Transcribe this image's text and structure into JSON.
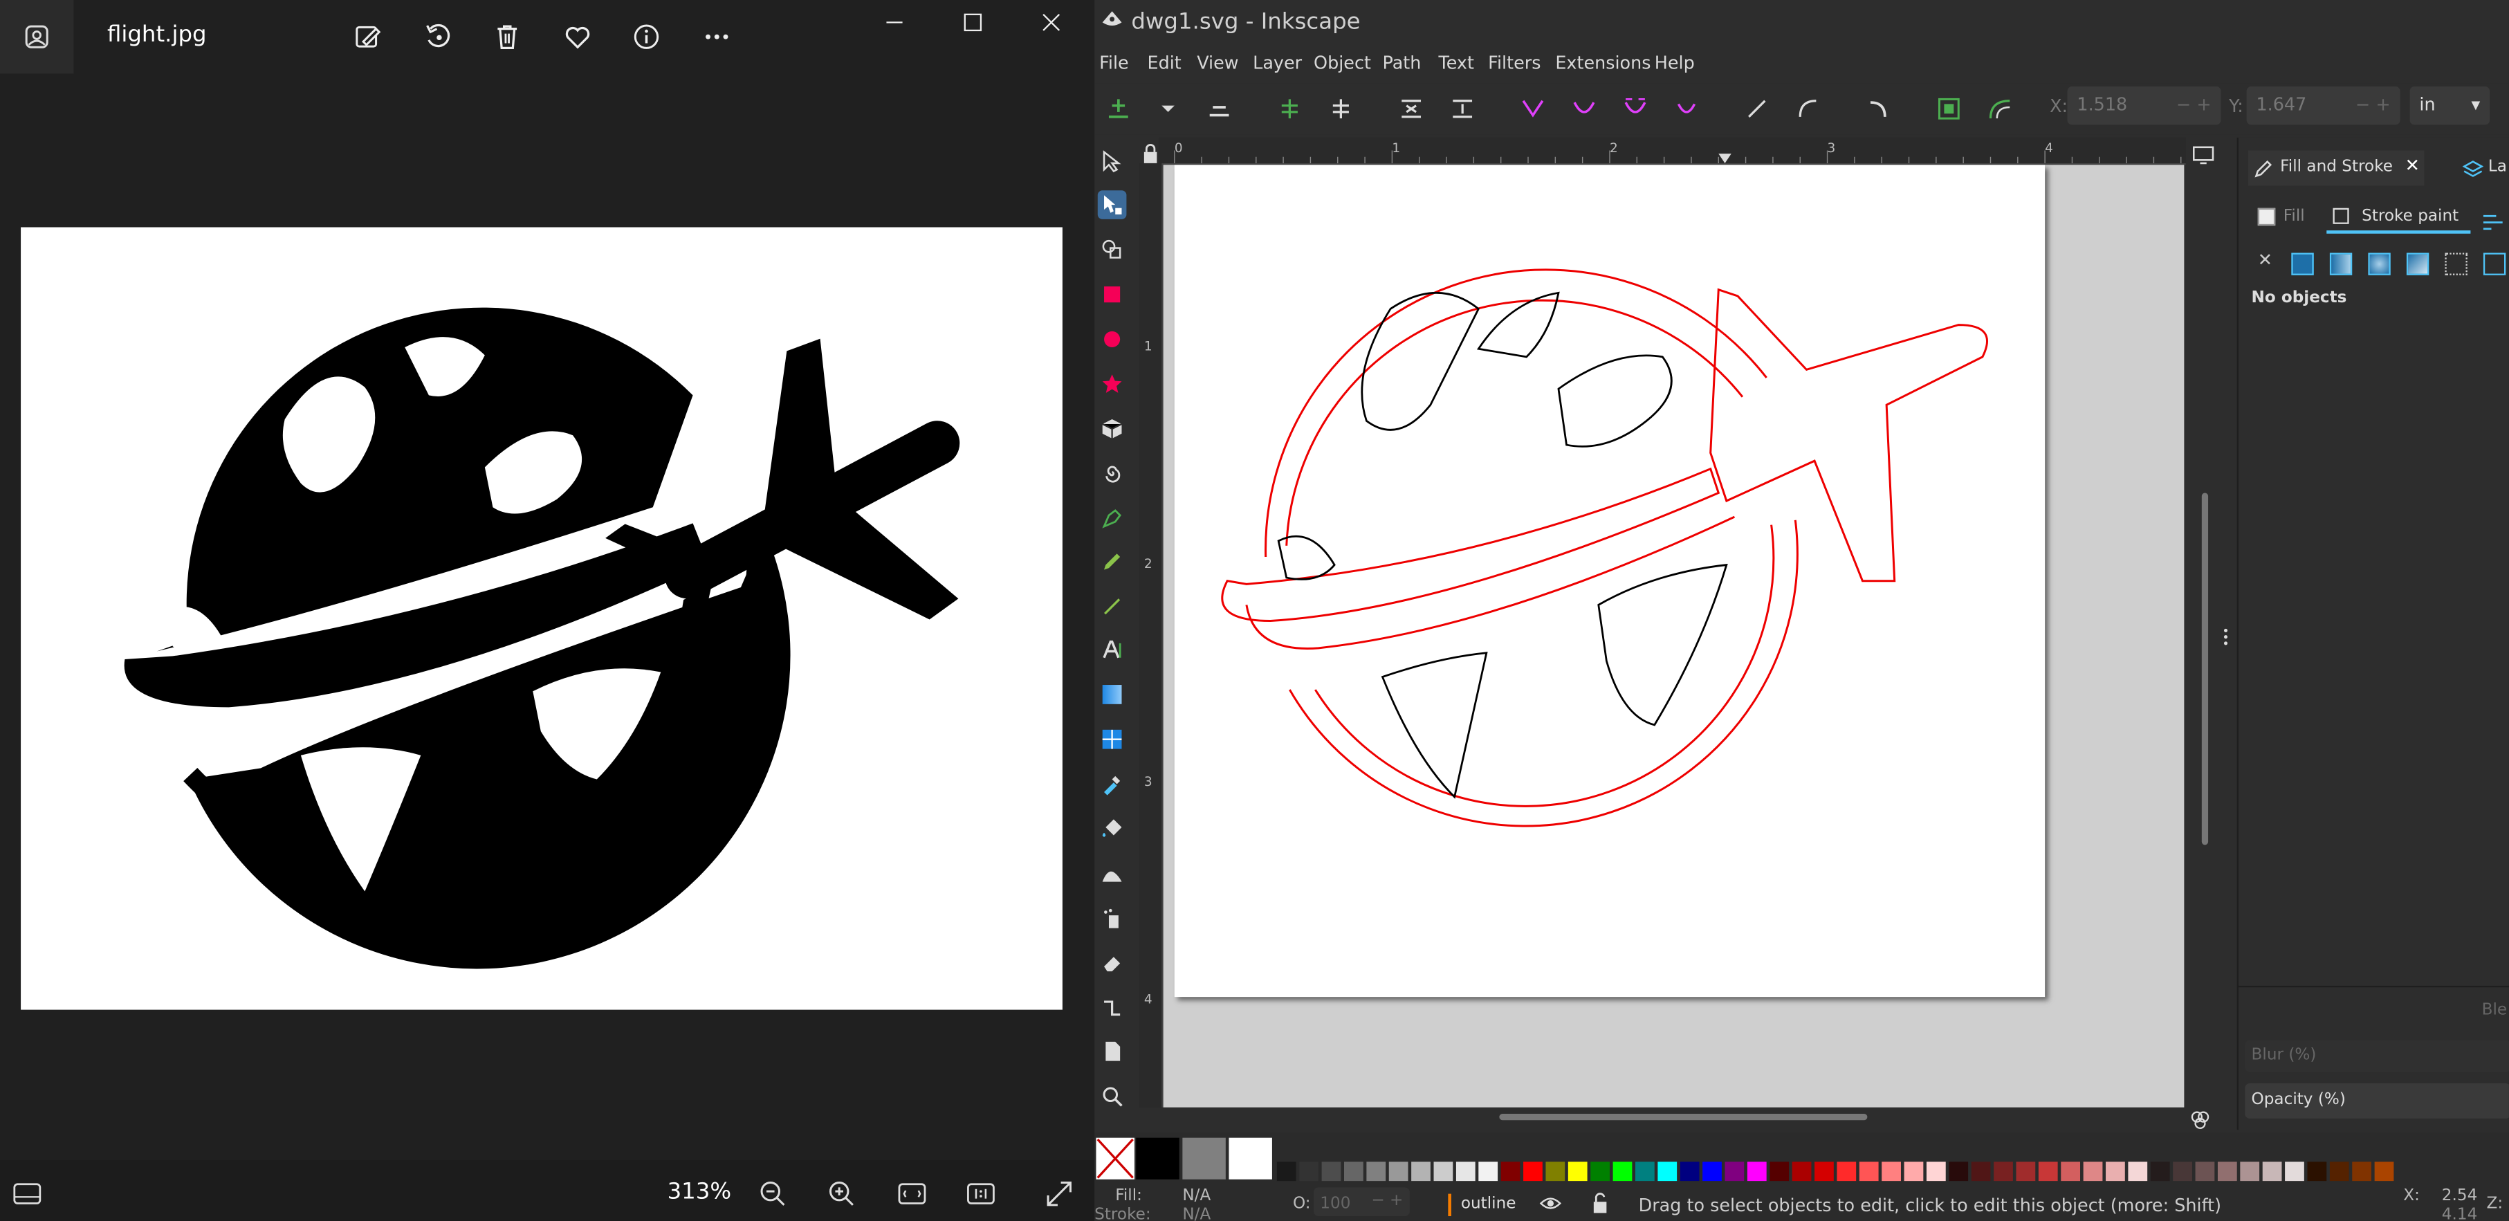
{
  "photos": {
    "file_name": "flight.jpg",
    "zoom": "313%",
    "toolbar_icons": [
      "edit-image-icon",
      "rotate-icon",
      "delete-icon",
      "favorite-icon",
      "info-icon",
      "more-icon"
    ],
    "window_controls": [
      "minimize-icon",
      "maximize-icon",
      "close-icon"
    ],
    "bottom_icons": [
      "filmstrip-icon",
      "zoom-out-icon",
      "zoom-in-icon",
      "fit-window-icon",
      "actual-size-icon",
      "fullscreen-icon"
    ]
  },
  "inkscape": {
    "title": "dwg1.svg - Inkscape",
    "menu": [
      "File",
      "Edit",
      "View",
      "Layer",
      "Object",
      "Path",
      "Text",
      "Filters",
      "Extensions",
      "Help"
    ],
    "coords": {
      "x_label": "X:",
      "x_value": "1.518",
      "y_label": "Y:",
      "y_value": "1.647",
      "unit": "in"
    },
    "ruler": [
      "0",
      "1",
      "2",
      "3",
      "4"
    ],
    "ruler_v": [
      "1",
      "2",
      "3",
      "4"
    ],
    "dock": {
      "tab_fill_stroke": "Fill and Stroke",
      "tab_layers": "La",
      "subtab_fill": "Fill",
      "subtab_stroke_paint": "Stroke paint",
      "no_objects": "No objects",
      "blend_label": "Ble",
      "blur_label": "Blur (%)",
      "opacity_label": "Opacity (%)"
    },
    "status": {
      "fill_label": "Fill:",
      "fill_value": "N/A",
      "stroke_label": "Stroke:",
      "stroke_value": "N/A",
      "opacity_label": "O:",
      "opacity_value": "100",
      "layer": "outline",
      "message": "Drag to select objects to edit, click to edit this object (more: Shift)",
      "x_label": "X:",
      "x_value": "2.54",
      "y_label": "Y:",
      "y_value": "4.14",
      "z_label": "Z:"
    },
    "palette_colors": [
      "#000000",
      "#808080",
      "#ffffff",
      "#1a1a1a",
      "#333333",
      "#4d4d4d",
      "#666666",
      "#808080",
      "#999999",
      "#b3b3b3",
      "#cccccc",
      "#e6e6e6",
      "#f2f2f2",
      "#800000",
      "#ff0000",
      "#808000",
      "#ffff00",
      "#008000",
      "#00ff00",
      "#008080",
      "#00ffff",
      "#000080",
      "#0000ff",
      "#800080",
      "#ff00ff",
      "#550000",
      "#aa0000",
      "#d40000",
      "#ff2a2a",
      "#ff5555",
      "#ff8080",
      "#ffaaaa",
      "#ffd5d5",
      "#280b0b",
      "#501616",
      "#782121",
      "#a02c2c",
      "#c83737",
      "#d35f5f",
      "#de8787",
      "#e9afaf",
      "#f4d7d7",
      "#241c1c",
      "#483737",
      "#6c5353",
      "#916f6f",
      "#ac9393",
      "#c8b7b7",
      "#e3dbdb",
      "#2b1100",
      "#552200",
      "#803300",
      "#aa4400"
    ]
  }
}
